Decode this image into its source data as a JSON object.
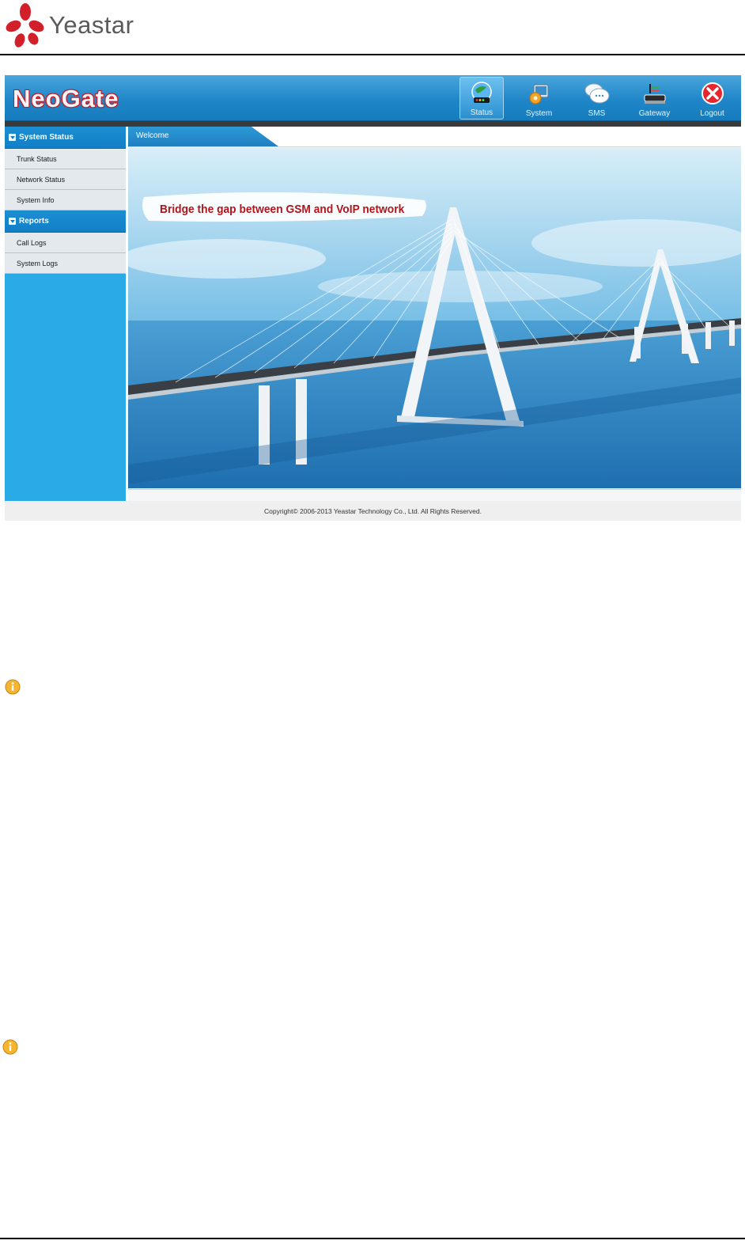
{
  "document": {
    "logo_text": "Yeastar"
  },
  "app": {
    "brand": "NeoGate",
    "nav": [
      {
        "label": "Status",
        "icon": "status-icon",
        "active": true
      },
      {
        "label": "System",
        "icon": "system-icon",
        "active": false
      },
      {
        "label": "SMS",
        "icon": "sms-icon",
        "active": false
      },
      {
        "label": "Gateway",
        "icon": "gateway-icon",
        "active": false
      },
      {
        "label": "Logout",
        "icon": "logout-icon",
        "active": false
      }
    ],
    "sidebar": {
      "sections": [
        {
          "title": "System Status",
          "items": [
            "Trunk Status",
            "Network Status",
            "System Info"
          ]
        },
        {
          "title": "Reports",
          "items": [
            "Call Logs",
            "System Logs"
          ]
        }
      ]
    },
    "main": {
      "tab": "Welcome",
      "tagline": "Bridge the gap between GSM and VoIP network"
    },
    "footer": "Copyright© 2006-2013 Yeastar Technology Co., Ltd. All Rights Reserved."
  },
  "colors": {
    "accent": "#1f86c8",
    "sidebar": "#2aaae6",
    "tagline": "#b3141c",
    "logo_red": "#d2202a"
  },
  "icons": [
    "info-icon",
    "info-icon"
  ]
}
